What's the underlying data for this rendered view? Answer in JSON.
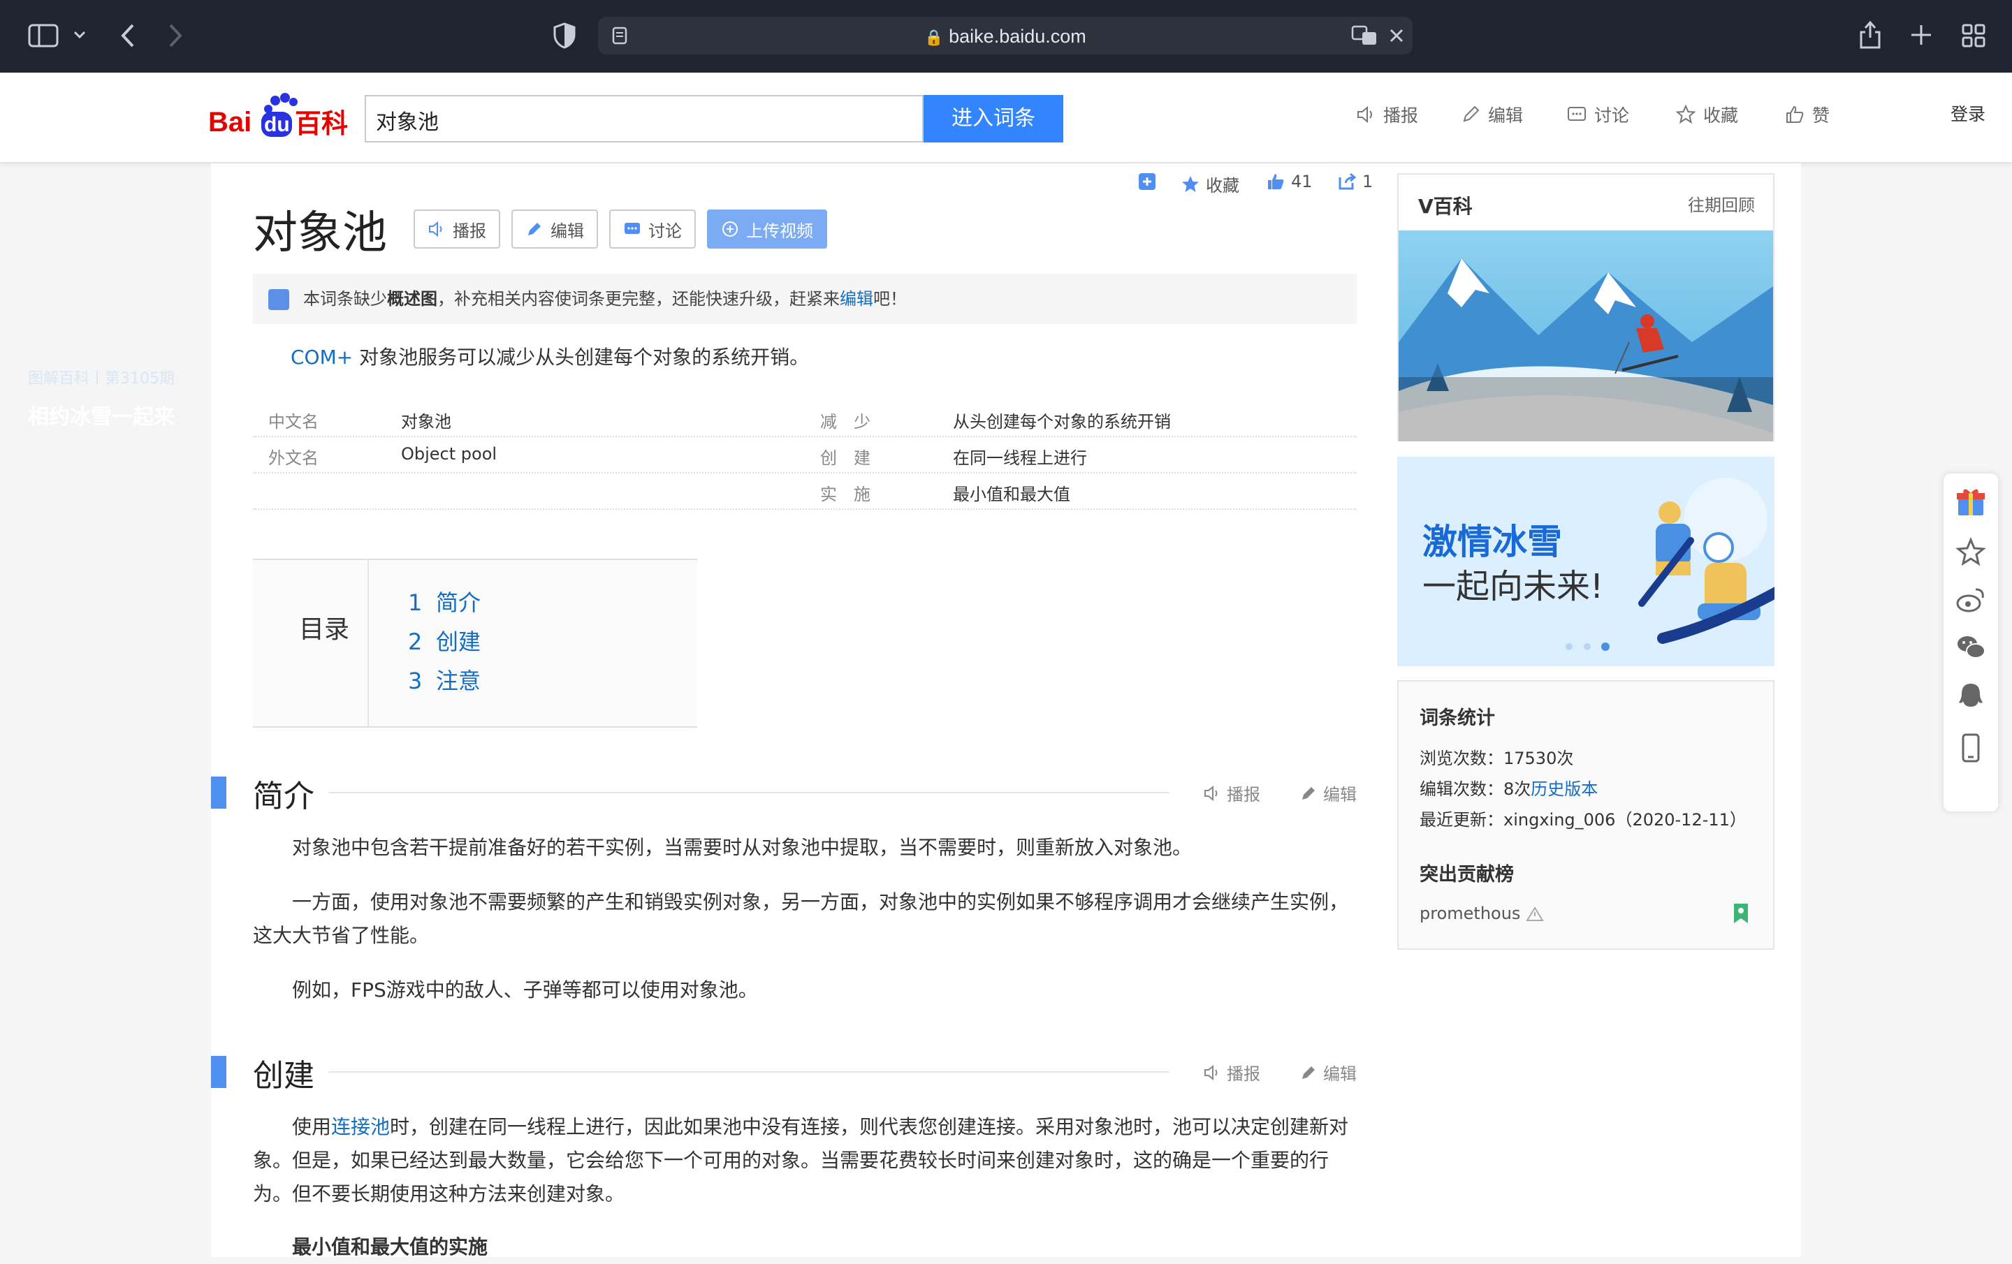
{
  "browser": {
    "url": "baike.baidu.com"
  },
  "header": {
    "logo_text": "Bai百科",
    "search_value": "对象池",
    "search_button": "进入词条",
    "nav": [
      "播报",
      "编辑",
      "讨论",
      "收藏",
      "赞"
    ],
    "login": "登录"
  },
  "article": {
    "title": "对象池",
    "title_buttons": [
      "播报",
      "编辑",
      "讨论",
      "上传视频"
    ],
    "stats": {
      "favorite": "收藏",
      "likes": "41",
      "shares": "1"
    },
    "notice": {
      "before": "本词条缺少",
      "bold": "概述图",
      "middle": "，补充相关内容使词条更完整，还能快速升级，赶紧来",
      "link": "编辑",
      "after": "吧！"
    },
    "lead": {
      "link": "COM+",
      "text": " 对象池服务可以减少从头创建每个对象的系统开销。"
    },
    "basic_info": {
      "left": [
        {
          "key": "中文名",
          "value": "对象池"
        },
        {
          "key": "外文名",
          "value": "Object pool"
        }
      ],
      "right": [
        {
          "key": "减　少",
          "value": "从头创建每个对象的系统开销"
        },
        {
          "key": "创　建",
          "value": "在同一线程上进行"
        },
        {
          "key": "实　施",
          "value": "最小值和最大值"
        }
      ]
    },
    "toc": {
      "title": "目录",
      "items": [
        {
          "num": "1",
          "label": "简介"
        },
        {
          "num": "2",
          "label": "创建"
        },
        {
          "num": "3",
          "label": "注意"
        }
      ]
    },
    "section_actions": {
      "listen": "播报",
      "edit": "编辑"
    },
    "sections": [
      {
        "title": "简介",
        "paragraphs": [
          "对象池中包含若干提前准备好的若干实例，当需要时从对象池中提取，当不需要时，则重新放入对象池。",
          "一方面，使用对象池不需要频繁的产生和销毁实例对象，另一方面，对象池中的实例如果不够程序调用才会继续产生实例，这大大节省了性能。",
          "例如，FPS游戏中的敌人、子弹等都可以使用对象池。"
        ]
      },
      {
        "title": "创建",
        "p1_before": "使用",
        "p1_link": "连接池",
        "p1_after": "时，创建在同一线程上进行，因此如果池中没有连接，则代表您创建连接。采用对象池时，池可以决定创建新对象。但是，如果已经达到最大数量，它会给您下一个可用的对象。当需要花费较长时间来创建对象时，这的确是一个重要的行为。但不要长期使用这种方法来创建对象。",
        "subheading": "最小值和最大值的实施"
      }
    ]
  },
  "sidebar": {
    "vbaike": {
      "title": "V百科",
      "history": "往期回顾",
      "caption_small": "图解百科丨第3105期",
      "caption_big": "相约冰雪一起来"
    },
    "banner": {
      "line1": "激情冰雪",
      "line2": "一起向未来!"
    },
    "stats": {
      "title": "词条统计",
      "views_label": "浏览次数：",
      "views": "17530次",
      "edits_label": "编辑次数：",
      "edits": "8次",
      "history_link": "历史版本",
      "updated_label": "最近更新：",
      "updated": "xingxing_006（2020-12-11）",
      "contrib_title": "突出贡献榜",
      "contributor": "promethous"
    }
  },
  "colors": {
    "accent": "#3385ff",
    "link": "#136ec2",
    "section_bar": "#4f8ff0"
  }
}
